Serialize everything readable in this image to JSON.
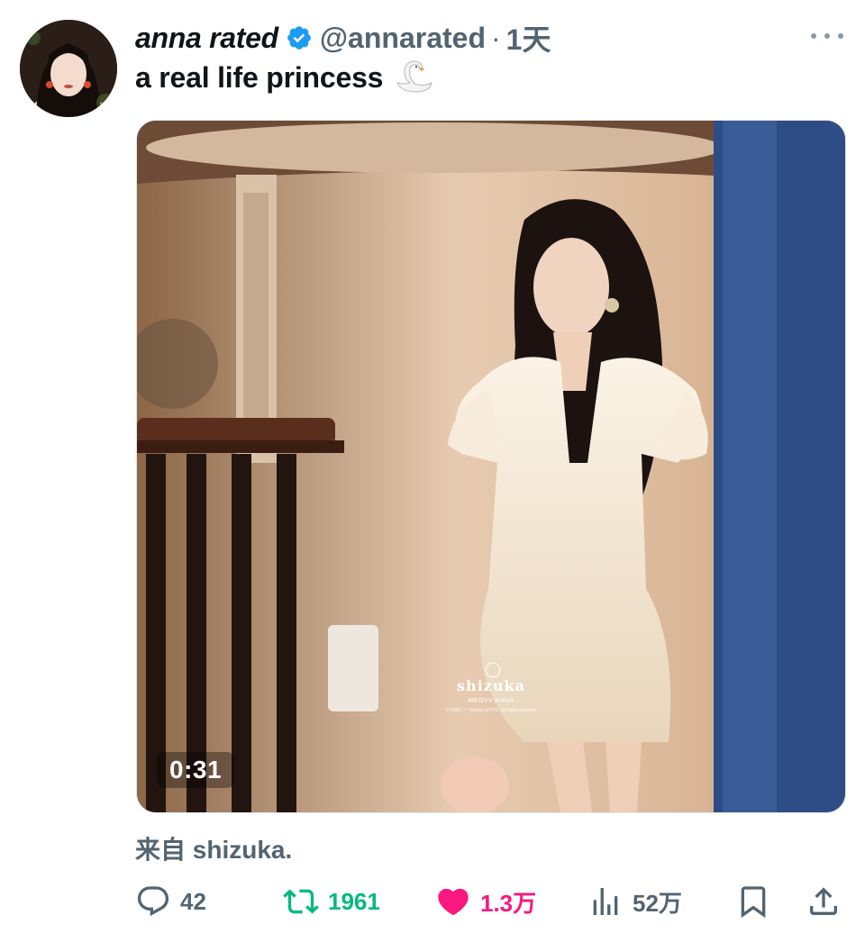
{
  "tweet": {
    "author_name": "anna rated",
    "author_handle": "@annarated",
    "separator": "·",
    "time": "1天",
    "text": "a real life princess",
    "emoji_icon": "swan-icon",
    "verified_icon": "verified-badge-icon",
    "more_icon": "more-options-icon"
  },
  "media": {
    "type": "video",
    "duration": "0:31",
    "watermark": {
      "brand": "shizuka",
      "subtitle": "MEOVV ANNA",
      "copyright": "© 2026, ⓢ shizuka.OOTD. all rights reserved"
    }
  },
  "source_label": "来自 shizuka.",
  "actions": {
    "replies": {
      "icon": "reply-icon",
      "count": "42",
      "color": "#536471"
    },
    "reposts": {
      "icon": "repost-icon",
      "count": "1961",
      "color": "#00ba7c"
    },
    "likes": {
      "icon": "heart-icon",
      "count": "1.3万",
      "color": "#f91880"
    },
    "views": {
      "icon": "views-icon",
      "count": "52万",
      "color": "#536471"
    },
    "bookmark": {
      "icon": "bookmark-icon"
    },
    "share": {
      "icon": "share-icon"
    }
  }
}
